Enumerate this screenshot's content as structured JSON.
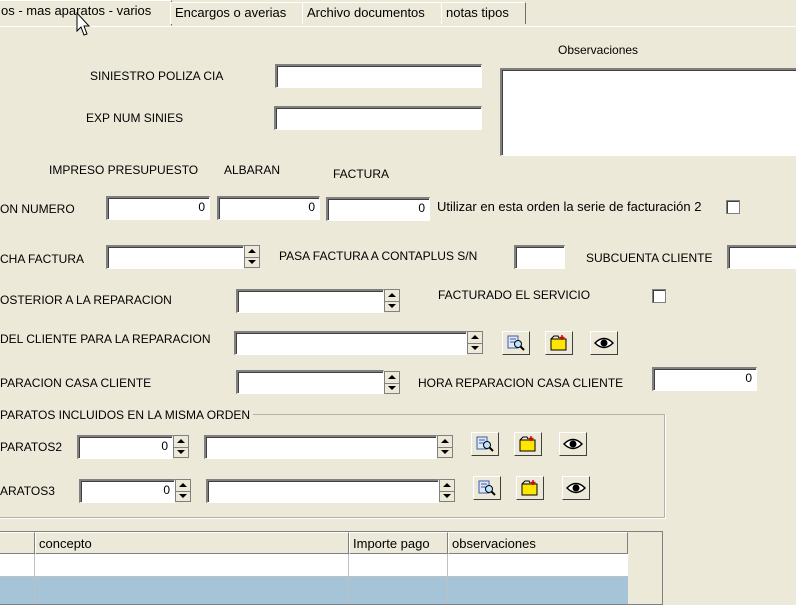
{
  "tabs": [
    "os - mas aparatos - varios",
    "Encargos o averias",
    "Archivo documentos",
    "notas tipos"
  ],
  "labels": {
    "observaciones": "Observaciones",
    "siniestro": "SINIESTRO POLIZA CIA",
    "exp": "EXP NUM SINIES",
    "impreso": "IMPRESO PRESUPUESTO",
    "albaran": "ALBARAN",
    "factura": "FACTURA",
    "on_numero": "ON NUMERO",
    "serie2": "Utilizar en esta orden la serie de facturación 2",
    "cha_factura": "CHA FACTURA",
    "contaplus": "PASA FACTURA A CONTAPLUS S/N",
    "subcuenta": "SUBCUENTA CLIENTE",
    "posterior": "OSTERIOR A LA REPARACION",
    "facturado": "FACTURADO EL SERVICIO",
    "del_cliente": "DEL CLIENTE PARA LA REPARACION",
    "reparacion_casa": "PARACION CASA CLIENTE",
    "hora_reparacion": "HORA  REPARACION CASA CLIENTE",
    "group_title": "PARATOS INCLUIDOS EN LA MISMA ORDEN",
    "aparatos2": "PARATOS2",
    "aparatos3": "ARATOS3"
  },
  "values": {
    "impreso": "0",
    "albaran": "0",
    "factura": "0",
    "hora": "0",
    "aparatos2": "0",
    "aparatos3": "0"
  },
  "grid": {
    "columns": [
      "",
      "concepto",
      "Importe pago",
      "observaciones"
    ]
  },
  "colors": {
    "face": "#ece9d8",
    "selected_row": "#a6c4d8"
  }
}
